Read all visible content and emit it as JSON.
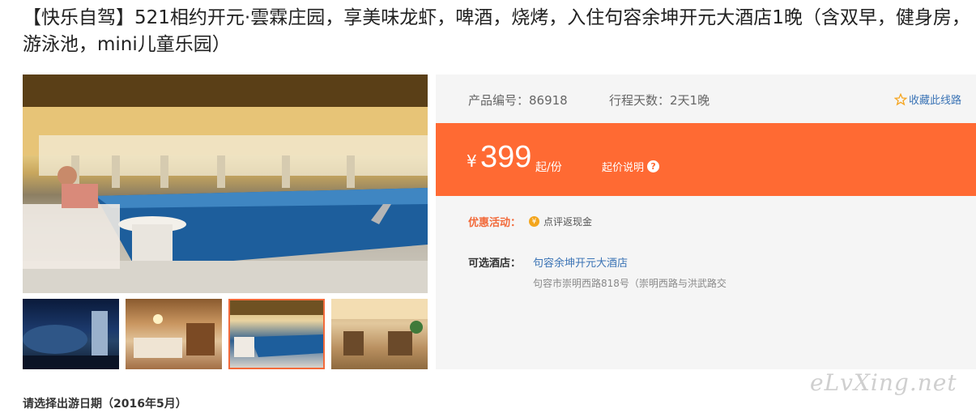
{
  "title": "【快乐自驾】521相约开元·雲霖庄园，享美味龙虾，啤酒，烧烤，入住句容余坤开元大酒店1晚（含双早，健身房，游泳池，mini儿童乐园）",
  "gallery": {
    "main_photo": "hotel-indoor-pool-photo",
    "thumbnails": [
      "hotel-exterior-night",
      "hotel-room",
      "hotel-indoor-pool",
      "hotel-lobby"
    ],
    "active_index": 2
  },
  "info": {
    "product_no": "产品编号：86918",
    "days": "行程天数：2天1晚",
    "favorite": "收藏此线路"
  },
  "price": {
    "currency": "¥",
    "amount": "399",
    "unit": "起/份",
    "note": "起价说明"
  },
  "promo": {
    "label": "优惠活动：",
    "text": "点评返现金"
  },
  "hotel": {
    "label": "可选酒店：",
    "name": "句容余坤开元大酒店",
    "address": "句容市崇明西路818号（崇明西路与洪武路交"
  },
  "watermark": "eLvXing.net",
  "date_section": "请选择出游日期（2016年5月）",
  "colors": {
    "accent": "#ff6a33",
    "link": "#3a73b5",
    "panel_bg": "#f5f5f5"
  }
}
